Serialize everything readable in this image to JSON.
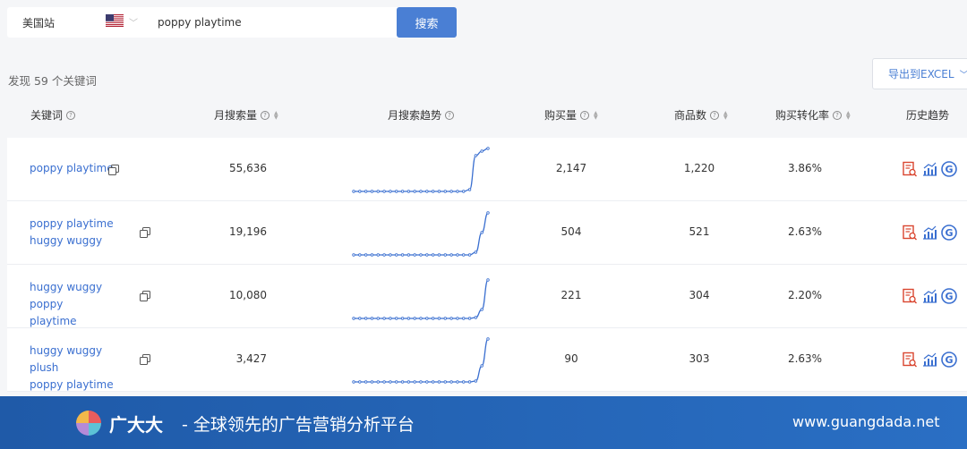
{
  "search": {
    "site": "美国站",
    "query": "poppy playtime",
    "button": "搜索"
  },
  "summary": {
    "found": "发现 59 个关键词"
  },
  "toolbar": {
    "export": "导出到EXCEL"
  },
  "table": {
    "headers": {
      "keyword": "关键词",
      "monthly_search": "月搜索量",
      "search_trend": "月搜索趋势",
      "purchases": "购买量",
      "products": "商品数",
      "conversion": "购买转化率",
      "history": "历史趋势"
    },
    "rows": [
      {
        "keyword_line1": "poppy playtime",
        "keyword_line2": "",
        "monthly_search": "55,636",
        "purchases": "2,147",
        "products": "1,220",
        "conversion": "3.86%",
        "trend": [
          0,
          0,
          0,
          0,
          0,
          0,
          0,
          0,
          0,
          0,
          0,
          0,
          0,
          0,
          0,
          0,
          0,
          0,
          0,
          2,
          40,
          45,
          48
        ]
      },
      {
        "keyword_line1": "poppy playtime",
        "keyword_line2": "huggy wuggy",
        "monthly_search": "19,196",
        "purchases": "504",
        "products": "521",
        "conversion": "2.63%",
        "trend": [
          0,
          0,
          0,
          0,
          0,
          0,
          0,
          0,
          0,
          0,
          0,
          0,
          0,
          0,
          0,
          0,
          0,
          0,
          0,
          0,
          3,
          25,
          47
        ]
      },
      {
        "keyword_line1": "huggy wuggy poppy",
        "keyword_line2": "playtime",
        "monthly_search": "10,080",
        "purchases": "221",
        "products": "304",
        "conversion": "2.20%",
        "trend": [
          0,
          0,
          0,
          0,
          0,
          0,
          0,
          0,
          0,
          0,
          0,
          0,
          0,
          0,
          0,
          0,
          0,
          0,
          0,
          0,
          1,
          10,
          43
        ]
      },
      {
        "keyword_line1": "huggy wuggy plush",
        "keyword_line2": "poppy playtime",
        "monthly_search": "3,427",
        "purchases": "90",
        "products": "303",
        "conversion": "2.63%",
        "trend": [
          0,
          0,
          0,
          0,
          0,
          0,
          0,
          0,
          0,
          0,
          0,
          0,
          0,
          0,
          0,
          0,
          0,
          0,
          0,
          0,
          1,
          18,
          48
        ]
      }
    ]
  },
  "footer": {
    "brand": "广大大",
    "slogan": "- 全球领先的广告营销分析平台",
    "url": "www.guangdada.net"
  },
  "colors": {
    "accent": "#4a7fd4",
    "link": "#3a6fd0",
    "icon_red": "#d9452f",
    "banner": "#2263b6"
  }
}
